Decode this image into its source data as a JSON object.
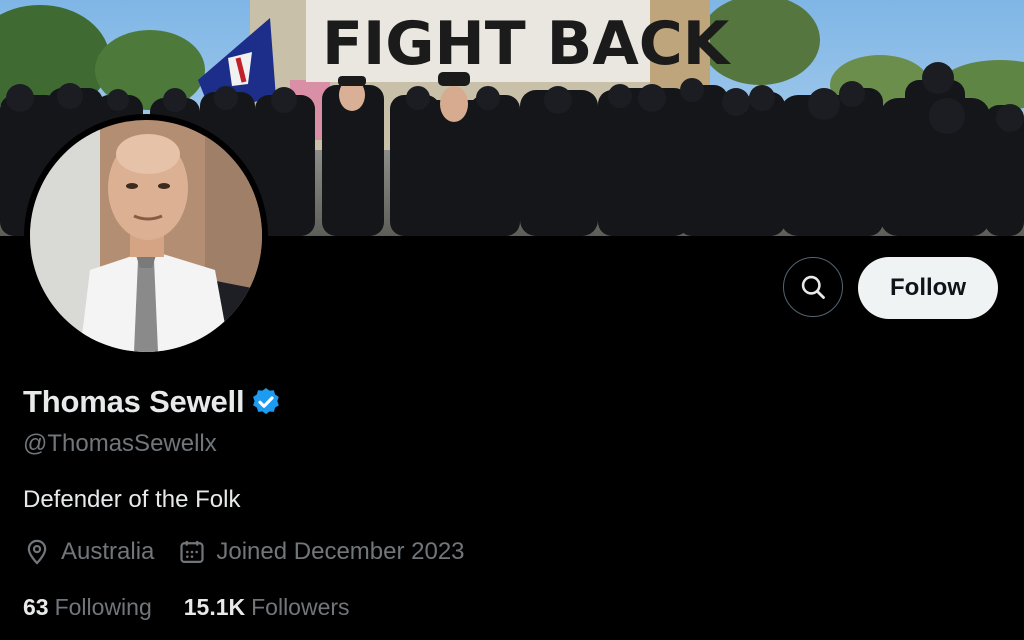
{
  "banner": {
    "sign_text": "FIGHT BACK"
  },
  "profile": {
    "display_name": "Thomas Sewell",
    "verified": true,
    "handle": "@ThomasSewellx",
    "bio": "Defender of the Folk",
    "location": "Australia",
    "joined": "Joined December 2023"
  },
  "actions": {
    "follow_label": "Follow"
  },
  "stats": {
    "following_count": "63",
    "following_label": "Following",
    "followers_count": "15.1K",
    "followers_label": "Followers"
  },
  "icons": {
    "search": "search-icon",
    "verified": "verified-badge-icon",
    "location": "location-pin-icon",
    "calendar": "calendar-icon"
  },
  "colors": {
    "background": "#000000",
    "primary_text": "#e7e9ea",
    "secondary_text": "#71767b",
    "verified_blue": "#1d9bf0",
    "follow_button_bg": "#eff3f4"
  }
}
